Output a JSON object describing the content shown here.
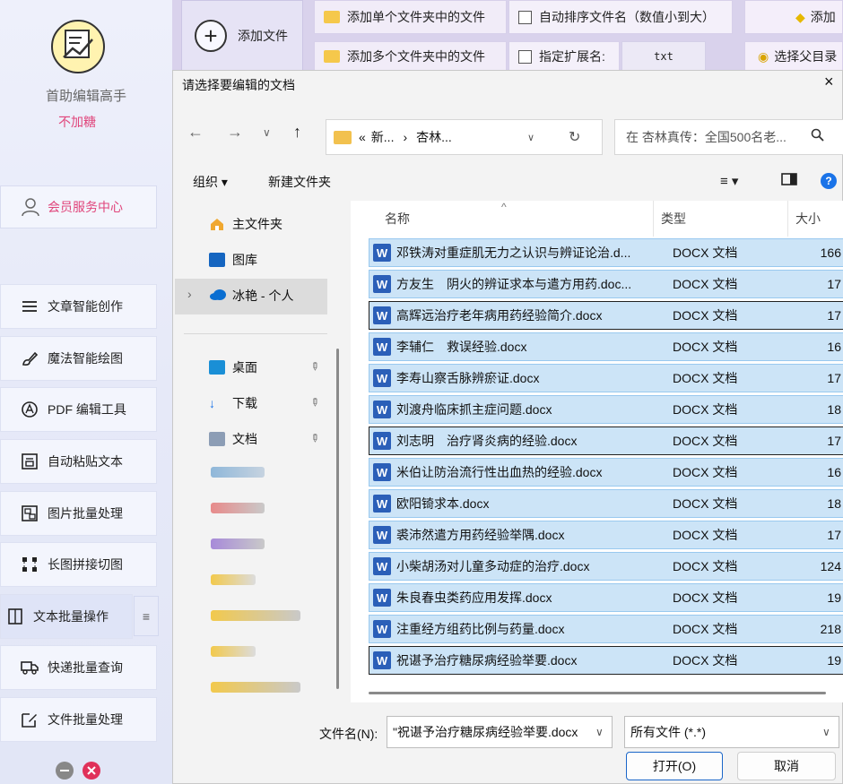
{
  "app": {
    "name": "首助编辑高手",
    "subtitle": "不加糖",
    "member_center": "会员服务中心",
    "nav": [
      {
        "label": "文章智能创作",
        "icon": "menu-icon"
      },
      {
        "label": "魔法智能绘图",
        "icon": "brush-icon"
      },
      {
        "label": "PDF 编辑工具",
        "icon": "pdf-icon"
      },
      {
        "label": "自动粘贴文本",
        "icon": "paste-icon"
      },
      {
        "label": "图片批量处理",
        "icon": "image-icon"
      },
      {
        "label": "长图拼接切图",
        "icon": "crop-icon"
      },
      {
        "label": "文本批量操作",
        "icon": "text-icon"
      },
      {
        "label": "快递批量查询",
        "icon": "truck-icon"
      },
      {
        "label": "文件批量处理",
        "icon": "file-edit-icon"
      }
    ],
    "active_nav": "文本批量操作",
    "colors": {
      "accent_pink": "#e0457b",
      "close_red": "#e0315a",
      "minimize_gray": "#888888"
    }
  },
  "toolbar": {
    "add_file": "添加文件",
    "add_single_folder": "添加单个文件夹中的文件",
    "add_multi_folder": "添加多个文件夹中的文件",
    "auto_sort": "自动排序文件名（数值小到大）",
    "specify_ext": "指定扩展名:",
    "ext_value": "txt",
    "add_cut": "添加",
    "select_parent": "选择父目录"
  },
  "dialog": {
    "title": "请选择要编辑的文档",
    "close": "×",
    "address_parts": [
      "«",
      "新...",
      "›",
      "杏林..."
    ],
    "search_placeholder": "在 杏林真传：全国500名老...",
    "organize": "组织 ▾",
    "new_folder": "新建文件夹",
    "nav_pane": {
      "home": "主文件夹",
      "gallery": "图库",
      "onedrive": "冰艳 - 个人",
      "desktop": "桌面",
      "downloads": "下载",
      "documents": "文档"
    },
    "columns": {
      "name": "名称",
      "type": "类型",
      "size": "大小"
    },
    "files": [
      {
        "name": "邓铁涛对重症肌无力之认识与辨证论治.d...",
        "type": "DOCX 文档",
        "size": "166"
      },
      {
        "name": "方友生　阴火的辨证求本与遣方用药.doc...",
        "type": "DOCX 文档",
        "size": "17"
      },
      {
        "name": "高辉远治疗老年病用药经验简介.docx",
        "type": "DOCX 文档",
        "size": "17"
      },
      {
        "name": "李辅仁　救误经验.docx",
        "type": "DOCX 文档",
        "size": "16"
      },
      {
        "name": "李寿山察舌脉辨瘀证.docx",
        "type": "DOCX 文档",
        "size": "17"
      },
      {
        "name": "刘渡舟临床抓主症问题.docx",
        "type": "DOCX 文档",
        "size": "18"
      },
      {
        "name": "刘志明　治疗肾炎病的经验.docx",
        "type": "DOCX 文档",
        "size": "17"
      },
      {
        "name": "米伯让防治流行性出血热的经验.docx",
        "type": "DOCX 文档",
        "size": "16"
      },
      {
        "name": "欧阳锜求本.docx",
        "type": "DOCX 文档",
        "size": "18"
      },
      {
        "name": "裘沛然遣方用药经验举隅.docx",
        "type": "DOCX 文档",
        "size": "17"
      },
      {
        "name": "小柴胡汤对儿童多动症的治疗.docx",
        "type": "DOCX 文档",
        "size": "124"
      },
      {
        "name": "朱良春虫类药应用发挥.docx",
        "type": "DOCX 文档",
        "size": "19"
      },
      {
        "name": "注重经方组药比例与药量.docx",
        "type": "DOCX 文档",
        "size": "218"
      },
      {
        "name": "祝谌予治疗糖尿病经验举要.docx",
        "type": "DOCX 文档",
        "size": "19"
      }
    ],
    "filename_label": "文件名(N):",
    "filename_value": "\"祝谌予治疗糖尿病经验举要.docx",
    "filter_value": "所有文件 (*.*)",
    "open_button": "打开(O)",
    "cancel_button": "取消",
    "colors": {
      "selection": "#cce4f7",
      "selection_border": "#99c9ef",
      "word_blue": "#2b5fb8",
      "help_blue": "#1a73e8"
    }
  }
}
